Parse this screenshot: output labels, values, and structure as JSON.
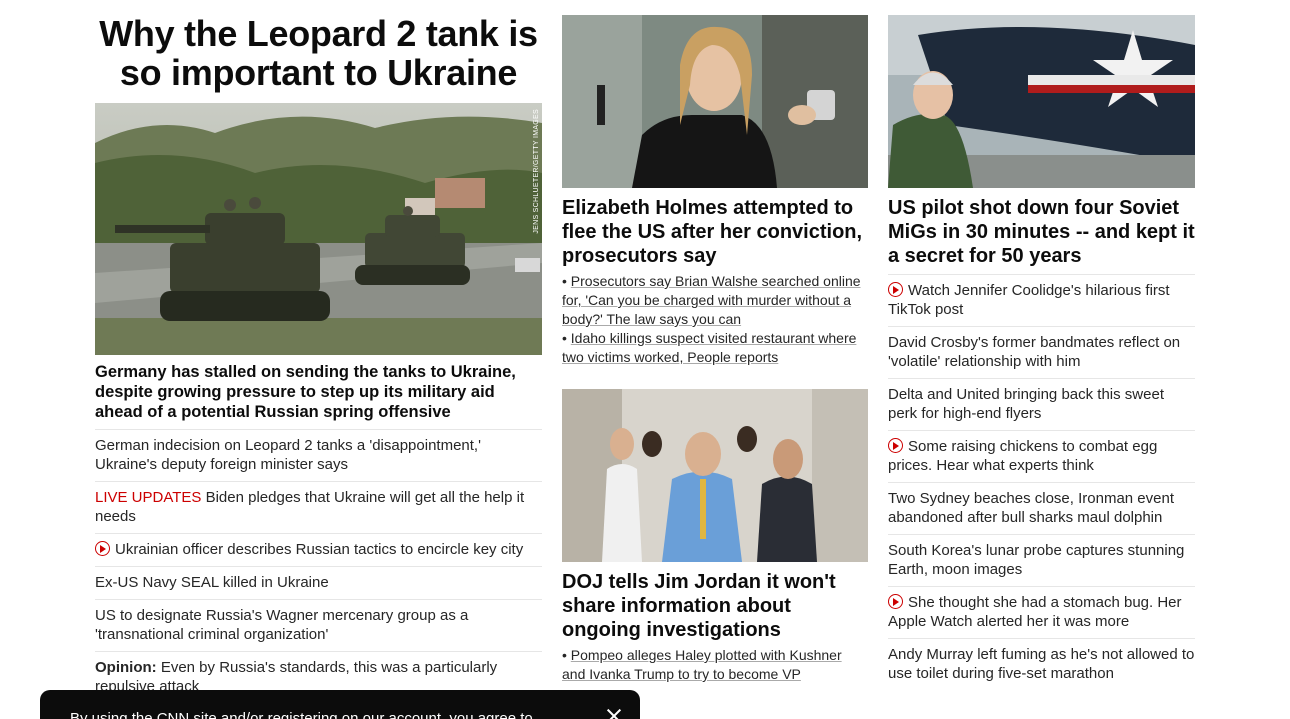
{
  "col1": {
    "hero_title": "Why the Leopard 2 tank is so important to Ukraine",
    "hero_image_credit": "JENS SCHLUETER/GETTY IMAGES",
    "lead_headline": "Germany has stalled on sending the tanks to Ukraine, despite growing pressure to step up its military aid ahead of a potential Russian spring offensive",
    "links": [
      {
        "text": "German indecision on Leopard 2 tanks a 'disappointment,' Ukraine's deputy foreign minister says"
      },
      {
        "prefix": "LIVE UPDATES",
        "text": "Biden pledges that Ukraine will get all the help it needs"
      },
      {
        "video": true,
        "text": "Ukrainian officer describes Russian tactics to encircle key city"
      },
      {
        "text": "Ex-US Navy SEAL killed in Ukraine"
      },
      {
        "text": "US to designate Russia's Wagner mercenary group as a 'transnational criminal organization'"
      },
      {
        "prefix": "Opinion:",
        "text": "Even by Russia's standards, this was a particularly repulsive attack"
      }
    ]
  },
  "col2": {
    "story1_headline": "Elizabeth Holmes attempted to flee the US after her conviction, prosecutors say",
    "story1_bullets": [
      "Prosecutors say Brian Walshe searched online for, 'Can you be charged with murder without a body?' The law says you can",
      "Idaho killings suspect visited restaurant where two victims worked, People reports"
    ],
    "story2_headline": "DOJ tells Jim Jordan it won't share information about ongoing investigations",
    "story2_bullets": [
      "Pompeo alleges Haley plotted with Kushner and Ivanka Trump to try to become VP"
    ]
  },
  "col3": {
    "headline": "US pilot shot down four Soviet MiGs in 30 minutes -- and kept it a secret for 50 years",
    "links": [
      {
        "video": true,
        "text": "Watch Jennifer Coolidge's hilarious first TikTok post"
      },
      {
        "text": "David Crosby's former bandmates reflect on 'volatile' relationship with him"
      },
      {
        "text": "Delta and United bringing back this sweet perk for high-end flyers"
      },
      {
        "video": true,
        "text": "Some raising chickens to combat egg prices. Hear what experts think"
      },
      {
        "text": "Two Sydney beaches close, Ironman event abandoned after bull sharks maul dolphin"
      },
      {
        "text": "South Korea's lunar probe captures stunning Earth, moon images"
      },
      {
        "video": true,
        "text": "She thought she had a stomach bug. Her Apple Watch alerted her it was more"
      },
      {
        "text": "Andy Murray left fuming as he's not allowed to use toilet during five-set marathon"
      }
    ]
  },
  "cookie_banner": {
    "text": "By using the CNN site and/or registering on our account, you agree to"
  }
}
